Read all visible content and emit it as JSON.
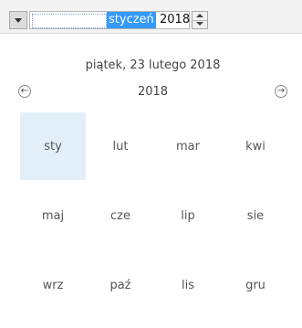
{
  "picker": {
    "month": "styczeń",
    "year": "2018"
  },
  "calendar": {
    "today": "piątek, 23 lutego 2018",
    "year": "2018",
    "prev_icon": "←",
    "next_icon": "→",
    "months": [
      "sty",
      "lut",
      "mar",
      "kwi",
      "maj",
      "cze",
      "lip",
      "sie",
      "wrz",
      "paź",
      "lis",
      "gru"
    ],
    "selected_month": "sty"
  },
  "colors": {
    "selection": "#3399ff",
    "selected_cell": "#e2eff9"
  }
}
